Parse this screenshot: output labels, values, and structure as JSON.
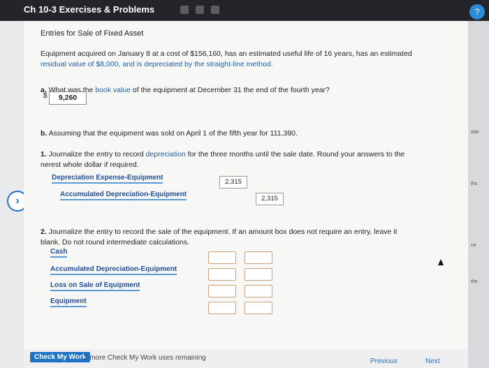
{
  "window": {
    "title": "Ch 10-3 Exercises & Problems"
  },
  "content": {
    "heading": "Entries for Sale of Fixed Asset",
    "intro_line1": "Equipment acquired on January 8 at a cost of $156,160, has an estimated useful life of 16 years, has an estimated",
    "intro_line2": "residual value of $8,000, and is depreciated by the straight-line method.",
    "qa_label": "a.",
    "qa_text_before": "What was the ",
    "qa_link": "book value",
    "qa_text_after": " of the equipment at December 31 the end of the fourth year?",
    "qa_prefix": "$",
    "qa_answer": "9,260",
    "qb_label": "b.",
    "qb_text": "Assuming that the equipment was sold on April 1 of the fifth year for 111,390.",
    "q1_label": "1.",
    "q1_before": "Journalize the entry to record ",
    "q1_link": "depreciation",
    "q1_after": " for the three months until the sale date. Round your answers to the",
    "q1_line2": "nerest whole dollar if required.",
    "entry1": [
      {
        "account": "Depreciation Expense-Equipment",
        "debit": "2,315"
      },
      {
        "account": "Accumulated Depreciation-Equipment",
        "credit": "2,315"
      }
    ],
    "q2_label": "2.",
    "q2_text": "Journalize the entry to record the sale of the equipment. If an amount box does not require an entry, leave it",
    "q2_line2": "blank. Do not round intermediate calculations.",
    "entry2": [
      {
        "account": "Cash"
      },
      {
        "account": "Accumulated Depreciation-Equipment"
      },
      {
        "account": "Loss on Sale of Equipment"
      },
      {
        "account": "Equipment"
      }
    ]
  },
  "footer": {
    "check_button": "Check My Work",
    "remaining": "2 more Check My Work uses remaining",
    "previous": "Previous",
    "next": "Next"
  },
  "icons": {
    "help": "help-icon",
    "nav_left": "chevron-left-icon"
  }
}
